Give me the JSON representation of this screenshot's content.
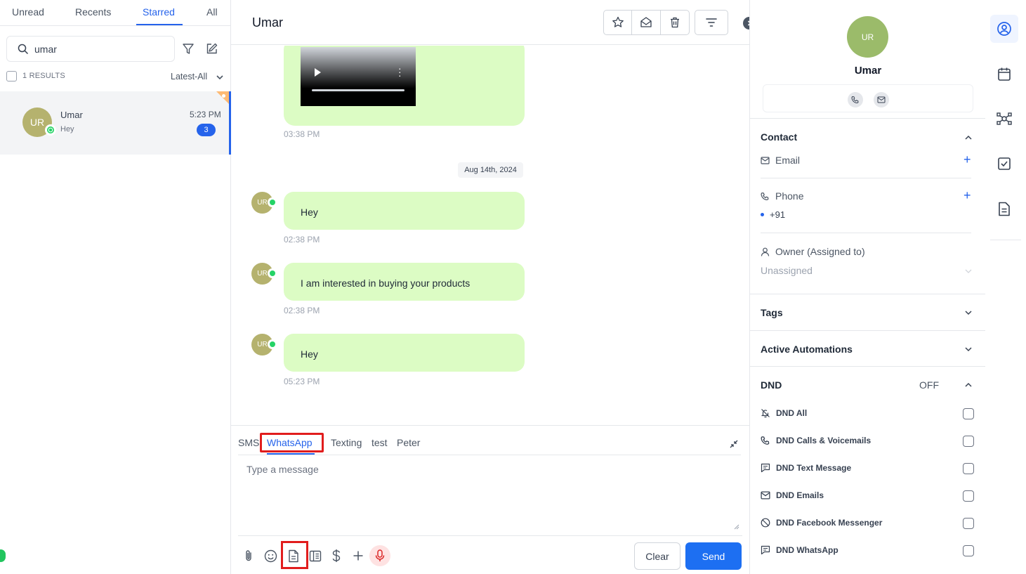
{
  "left": {
    "tabs": [
      "Unread",
      "Recents",
      "Starred",
      "All"
    ],
    "active_tab": "Starred",
    "search": {
      "value": "umar",
      "placeholder": "Search"
    },
    "results_label": "1 RESULTS",
    "sort_label": "Latest-All",
    "conversation": {
      "avatar": "UR",
      "name": "Umar",
      "preview": "Hey",
      "time": "5:23 PM",
      "unread": "3"
    }
  },
  "chat": {
    "title": "Umar",
    "header_icons": [
      "star-icon",
      "mail-icon",
      "trash-icon",
      "filter-lines-icon",
      "chevron-right-icon"
    ],
    "messages": [
      {
        "type": "video",
        "time": "03:38 PM"
      },
      {
        "type": "date",
        "label": "Aug 14th, 2024"
      },
      {
        "type": "text",
        "avatar": "UR",
        "text": "Hey",
        "time": "02:38 PM"
      },
      {
        "type": "text",
        "avatar": "UR",
        "text": "I am interested in buying your products",
        "time": "02:38 PM"
      },
      {
        "type": "text",
        "avatar": "UR",
        "text": "Hey",
        "time": "05:23 PM"
      }
    ],
    "composer": {
      "channels": [
        "SMS",
        "WhatsApp",
        "Texting",
        "test",
        "Peter"
      ],
      "active_channel": "WhatsApp",
      "placeholder": "Type a message",
      "tools": [
        "paperclip-icon",
        "emoji-icon",
        "document-icon",
        "template-icon",
        "dollar-icon",
        "plus-icon",
        "microphone-icon"
      ],
      "clear_label": "Clear",
      "send_label": "Send"
    }
  },
  "contact": {
    "avatar": "UR",
    "name": "Umar",
    "sections": {
      "contact": "Contact",
      "email_label": "Email",
      "phone_label": "Phone",
      "phone_value": "+91",
      "owner_label": "Owner (Assigned to)",
      "owner_value": "Unassigned",
      "tags": "Tags",
      "automations": "Active Automations",
      "dnd": "DND",
      "dnd_state": "OFF"
    },
    "dnd_items": [
      "DND All",
      "DND Calls & Voicemails",
      "DND Text Message",
      "DND Emails",
      "DND Facebook Messenger",
      "DND WhatsApp"
    ]
  },
  "rail": [
    "contact-icon",
    "calendar-icon",
    "network-icon",
    "task-icon",
    "notes-icon"
  ],
  "colors": {
    "accent": "#2563eb",
    "bubble": "#dcfcc4",
    "highlight": "#e11d1d",
    "avatar": "#b5b26e"
  }
}
